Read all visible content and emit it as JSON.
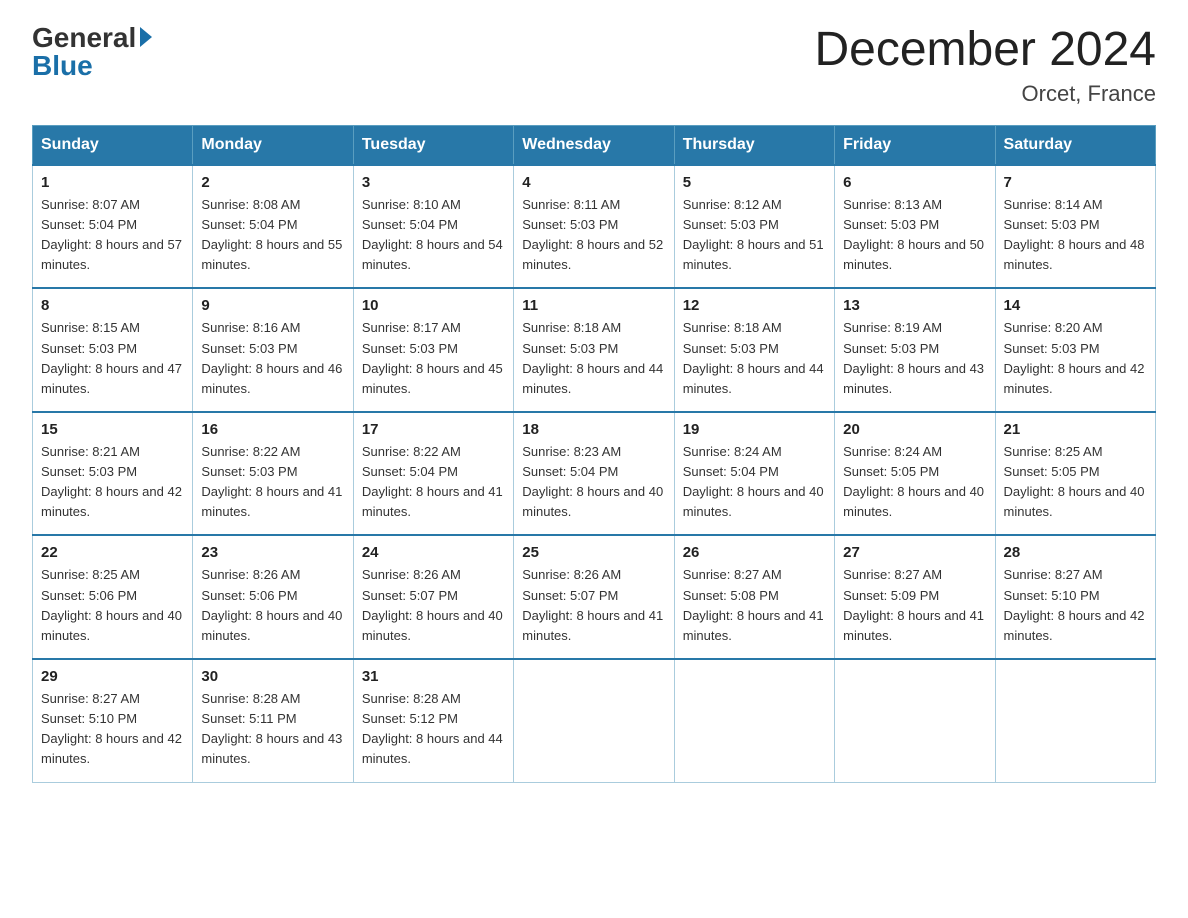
{
  "logo": {
    "general": "General",
    "blue": "Blue"
  },
  "title": "December 2024",
  "subtitle": "Orcet, France",
  "days": [
    "Sunday",
    "Monday",
    "Tuesday",
    "Wednesday",
    "Thursday",
    "Friday",
    "Saturday"
  ],
  "weeks": [
    [
      {
        "num": "1",
        "sunrise": "8:07 AM",
        "sunset": "5:04 PM",
        "daylight": "8 hours and 57 minutes."
      },
      {
        "num": "2",
        "sunrise": "8:08 AM",
        "sunset": "5:04 PM",
        "daylight": "8 hours and 55 minutes."
      },
      {
        "num": "3",
        "sunrise": "8:10 AM",
        "sunset": "5:04 PM",
        "daylight": "8 hours and 54 minutes."
      },
      {
        "num": "4",
        "sunrise": "8:11 AM",
        "sunset": "5:03 PM",
        "daylight": "8 hours and 52 minutes."
      },
      {
        "num": "5",
        "sunrise": "8:12 AM",
        "sunset": "5:03 PM",
        "daylight": "8 hours and 51 minutes."
      },
      {
        "num": "6",
        "sunrise": "8:13 AM",
        "sunset": "5:03 PM",
        "daylight": "8 hours and 50 minutes."
      },
      {
        "num": "7",
        "sunrise": "8:14 AM",
        "sunset": "5:03 PM",
        "daylight": "8 hours and 48 minutes."
      }
    ],
    [
      {
        "num": "8",
        "sunrise": "8:15 AM",
        "sunset": "5:03 PM",
        "daylight": "8 hours and 47 minutes."
      },
      {
        "num": "9",
        "sunrise": "8:16 AM",
        "sunset": "5:03 PM",
        "daylight": "8 hours and 46 minutes."
      },
      {
        "num": "10",
        "sunrise": "8:17 AM",
        "sunset": "5:03 PM",
        "daylight": "8 hours and 45 minutes."
      },
      {
        "num": "11",
        "sunrise": "8:18 AM",
        "sunset": "5:03 PM",
        "daylight": "8 hours and 44 minutes."
      },
      {
        "num": "12",
        "sunrise": "8:18 AM",
        "sunset": "5:03 PM",
        "daylight": "8 hours and 44 minutes."
      },
      {
        "num": "13",
        "sunrise": "8:19 AM",
        "sunset": "5:03 PM",
        "daylight": "8 hours and 43 minutes."
      },
      {
        "num": "14",
        "sunrise": "8:20 AM",
        "sunset": "5:03 PM",
        "daylight": "8 hours and 42 minutes."
      }
    ],
    [
      {
        "num": "15",
        "sunrise": "8:21 AM",
        "sunset": "5:03 PM",
        "daylight": "8 hours and 42 minutes."
      },
      {
        "num": "16",
        "sunrise": "8:22 AM",
        "sunset": "5:03 PM",
        "daylight": "8 hours and 41 minutes."
      },
      {
        "num": "17",
        "sunrise": "8:22 AM",
        "sunset": "5:04 PM",
        "daylight": "8 hours and 41 minutes."
      },
      {
        "num": "18",
        "sunrise": "8:23 AM",
        "sunset": "5:04 PM",
        "daylight": "8 hours and 40 minutes."
      },
      {
        "num": "19",
        "sunrise": "8:24 AM",
        "sunset": "5:04 PM",
        "daylight": "8 hours and 40 minutes."
      },
      {
        "num": "20",
        "sunrise": "8:24 AM",
        "sunset": "5:05 PM",
        "daylight": "8 hours and 40 minutes."
      },
      {
        "num": "21",
        "sunrise": "8:25 AM",
        "sunset": "5:05 PM",
        "daylight": "8 hours and 40 minutes."
      }
    ],
    [
      {
        "num": "22",
        "sunrise": "8:25 AM",
        "sunset": "5:06 PM",
        "daylight": "8 hours and 40 minutes."
      },
      {
        "num": "23",
        "sunrise": "8:26 AM",
        "sunset": "5:06 PM",
        "daylight": "8 hours and 40 minutes."
      },
      {
        "num": "24",
        "sunrise": "8:26 AM",
        "sunset": "5:07 PM",
        "daylight": "8 hours and 40 minutes."
      },
      {
        "num": "25",
        "sunrise": "8:26 AM",
        "sunset": "5:07 PM",
        "daylight": "8 hours and 41 minutes."
      },
      {
        "num": "26",
        "sunrise": "8:27 AM",
        "sunset": "5:08 PM",
        "daylight": "8 hours and 41 minutes."
      },
      {
        "num": "27",
        "sunrise": "8:27 AM",
        "sunset": "5:09 PM",
        "daylight": "8 hours and 41 minutes."
      },
      {
        "num": "28",
        "sunrise": "8:27 AM",
        "sunset": "5:10 PM",
        "daylight": "8 hours and 42 minutes."
      }
    ],
    [
      {
        "num": "29",
        "sunrise": "8:27 AM",
        "sunset": "5:10 PM",
        "daylight": "8 hours and 42 minutes."
      },
      {
        "num": "30",
        "sunrise": "8:28 AM",
        "sunset": "5:11 PM",
        "daylight": "8 hours and 43 minutes."
      },
      {
        "num": "31",
        "sunrise": "8:28 AM",
        "sunset": "5:12 PM",
        "daylight": "8 hours and 44 minutes."
      },
      null,
      null,
      null,
      null
    ]
  ]
}
